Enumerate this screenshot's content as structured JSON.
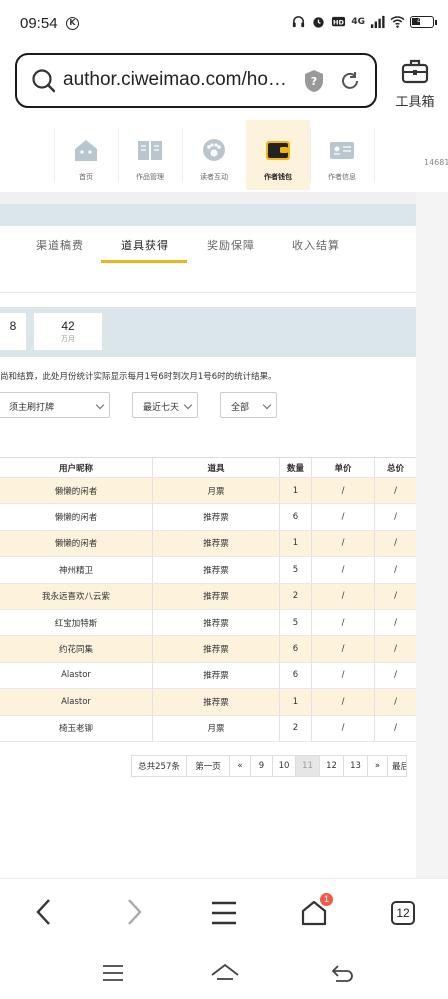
{
  "status_bar": {
    "time": "09:54",
    "network": "4G",
    "battery_label": "41",
    "battery_level_pct": 41,
    "icons": [
      "k-notification-icon",
      "headphones-icon",
      "alarm-icon",
      "hd-icon",
      "signal-icon",
      "wifi-icon",
      "battery-icon"
    ]
  },
  "browser": {
    "url": "author.ciweimao.com/ho…",
    "toolbox_label": "工具箱",
    "notification_badge": "1",
    "tab_count": "12"
  },
  "nav": {
    "items": [
      {
        "label": "首页",
        "icon": "home-icon"
      },
      {
        "label": "作品管理",
        "icon": "book-icon"
      },
      {
        "label": "读者互动",
        "icon": "paw-icon"
      },
      {
        "label": "作者钱包",
        "icon": "wallet-icon",
        "active": true
      },
      {
        "label": "作者信息",
        "icon": "id-card-icon"
      }
    ],
    "id_fragment": "14681"
  },
  "tabs": [
    {
      "label": "渠道稿费"
    },
    {
      "label": "道具获得",
      "active": true
    },
    {
      "label": "奖励保障"
    },
    {
      "label": "收入结算"
    }
  ],
  "stats": [
    {
      "value": "8",
      "unit": ""
    },
    {
      "value": "42",
      "unit": "万月"
    }
  ],
  "note": "尚和结算，此处月份统计实际显示每月1号6时到次月1号6时的统计结果。",
  "filters": {
    "book": "须主刷打牌",
    "range": "最近七天",
    "type": "全部"
  },
  "table": {
    "headers": [
      "用户昵称",
      "道具",
      "数量",
      "单价",
      "总价"
    ],
    "rows": [
      [
        "懒懒的闲者",
        "月票",
        "1",
        "/",
        "/"
      ],
      [
        "懒懒的闲者",
        "推荐票",
        "6",
        "/",
        "/"
      ],
      [
        "懒懒的闲者",
        "推荐票",
        "1",
        "/",
        "/"
      ],
      [
        "神州精卫",
        "推荐票",
        "5",
        "/",
        "/"
      ],
      [
        "我永远喜欢八云紫",
        "推荐票",
        "2",
        "/",
        "/"
      ],
      [
        "红宝加特斯",
        "推荐票",
        "5",
        "/",
        "/"
      ],
      [
        "约花同集",
        "推荐票",
        "6",
        "/",
        "/"
      ],
      [
        "Alastor",
        "推荐票",
        "6",
        "/",
        "/"
      ],
      [
        "Alastor",
        "推荐票",
        "1",
        "/",
        "/"
      ],
      [
        "椅玉老铆",
        "月票",
        "2",
        "/",
        "/"
      ]
    ]
  },
  "pager": {
    "total": "总共257条",
    "first": "第一页",
    "prev": "«",
    "pages": [
      "9",
      "10",
      "11",
      "12",
      "13"
    ],
    "current": "11",
    "next": "»",
    "last": "最后"
  },
  "colors": {
    "accent": "#f0b31a",
    "row_highlight": "#fdf3dd",
    "band": "#dbe6eb",
    "badge": "#f05a4a"
  }
}
